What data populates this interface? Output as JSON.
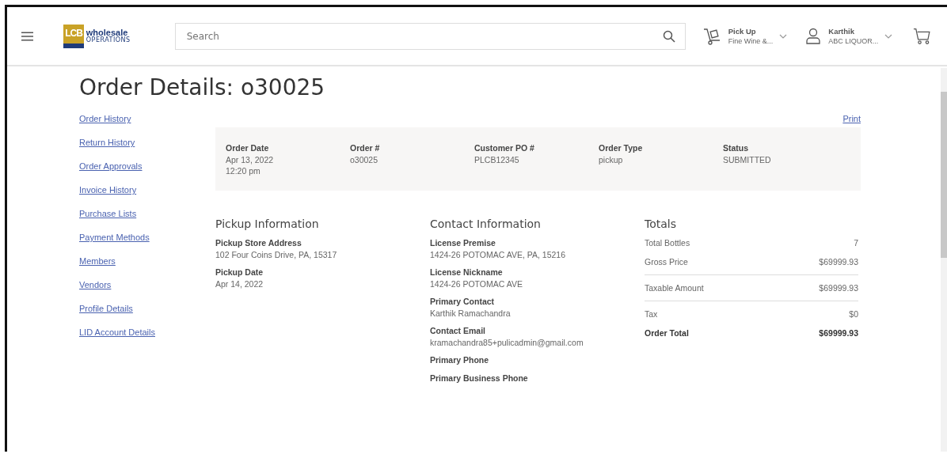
{
  "header": {
    "logo": {
      "mark": "LCB",
      "name": "wholesale",
      "tagline": "OPERATIONS"
    },
    "search": {
      "placeholder": "Search"
    },
    "fulfillment": {
      "label": "Pick Up",
      "value": "Fine Wine &..."
    },
    "account": {
      "label": "Karthik",
      "value": "ABC LIQUOR..."
    }
  },
  "title": "Order Details: o30025",
  "sidebar": {
    "items": [
      {
        "label": "Order History"
      },
      {
        "label": "Return History"
      },
      {
        "label": "Order Approvals"
      },
      {
        "label": "Invoice History"
      },
      {
        "label": "Purchase Lists"
      },
      {
        "label": "Payment Methods"
      },
      {
        "label": "Members"
      },
      {
        "label": "Vendors"
      },
      {
        "label": "Profile Details"
      },
      {
        "label": "LID Account Details"
      }
    ]
  },
  "print_link": "Print",
  "summary": [
    {
      "label": "Order Date",
      "lines": [
        "Apr 13, 2022",
        "12:20 pm"
      ]
    },
    {
      "label": "Order #",
      "lines": [
        "o30025"
      ]
    },
    {
      "label": "Customer PO #",
      "lines": [
        "PLCB12345"
      ]
    },
    {
      "label": "Order Type",
      "lines": [
        "pickup"
      ]
    },
    {
      "label": "Status",
      "lines": [
        "SUBMITTED"
      ]
    }
  ],
  "pickup": {
    "heading": "Pickup Information",
    "fields": [
      {
        "label": "Pickup Store Address",
        "value": "102 Four Coins Drive, PA, 15317"
      },
      {
        "label": "Pickup Date",
        "value": "Apr 14, 2022"
      }
    ]
  },
  "contact": {
    "heading": "Contact Information",
    "fields": [
      {
        "label": "License Premise",
        "value": "1424-26 POTOMAC AVE, PA, 15216"
      },
      {
        "label": "License Nickname",
        "value": "1424-26 POTOMAC AVE"
      },
      {
        "label": "Primary Contact",
        "value": "Karthik Ramachandra"
      },
      {
        "label": "Contact Email",
        "value": "kramachandra85+pulicadmin@gmail.com"
      },
      {
        "label": "Primary Phone"
      },
      {
        "label": "Primary Business Phone"
      }
    ]
  },
  "totals": {
    "heading": "Totals",
    "rows": [
      {
        "label": "Total Bottles",
        "value": "7",
        "kind": "line",
        "divider": false
      },
      {
        "label": "Gross Price",
        "value": "$69999.93",
        "kind": "line",
        "divider": true
      },
      {
        "label": "Taxable Amount",
        "value": "$69999.93",
        "kind": "line",
        "divider": true
      },
      {
        "label": "Tax",
        "value": "$0",
        "kind": "line",
        "divider": false
      },
      {
        "label": "Order Total",
        "value": "$69999.93",
        "kind": "total",
        "divider": false
      }
    ]
  }
}
